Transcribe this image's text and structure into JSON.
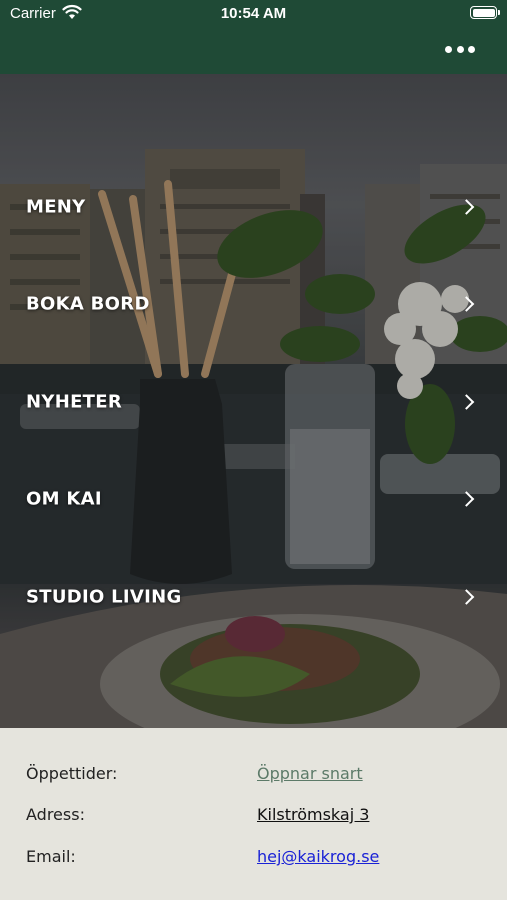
{
  "status_bar": {
    "carrier": "Carrier",
    "time": "10:54 AM"
  },
  "header": {
    "more_icon": "more-horizontal-icon"
  },
  "menu": {
    "items": [
      {
        "label": "MENY"
      },
      {
        "label": "BOKA BORD"
      },
      {
        "label": "NYHETER"
      },
      {
        "label": "OM KAI"
      },
      {
        "label": "STUDIO LIVING"
      }
    ]
  },
  "info": {
    "hours_label": "Öppettider:",
    "hours_value": "Öppnar snart",
    "address_label": "Adress:",
    "address_value": "Kilströmskaj 3",
    "email_label": "Email:",
    "email_value": "hej@kaikrog.se"
  },
  "colors": {
    "header_bg": "#1f4a36",
    "info_bg": "#e5e4dd",
    "link_blue": "#1a22d6",
    "link_green": "#5c7a68"
  }
}
